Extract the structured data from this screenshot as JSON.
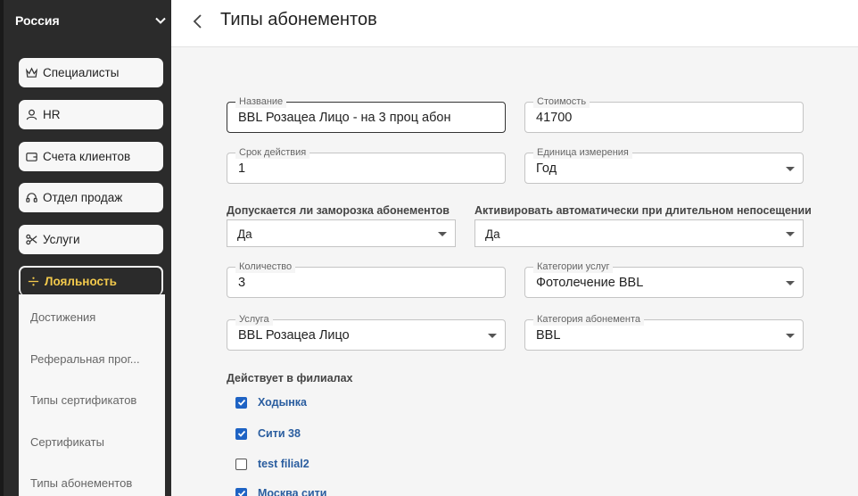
{
  "sidebar": {
    "region": "Россия",
    "items": [
      {
        "label": "Специалисты",
        "icon": "crown-icon"
      },
      {
        "label": "HR",
        "icon": "user-icon"
      },
      {
        "label": "Счета клиентов",
        "icon": "wallet-icon"
      },
      {
        "label": "Отдел продаж",
        "icon": "headset-icon"
      },
      {
        "label": "Услуги",
        "icon": "scissors-icon"
      },
      {
        "label": "Лояльность",
        "icon": "divide-icon"
      }
    ],
    "submenu": [
      "Достижения",
      "Реферальная прог...",
      "Типы сертификатов",
      "Сертификаты",
      "Типы абонементов"
    ]
  },
  "header": {
    "title": "Типы абонементов"
  },
  "form": {
    "name": {
      "label": "Название",
      "value": "BBL Розацеа Лицо - на 3 проц абон"
    },
    "price": {
      "label": "Стоимость",
      "value": "41700"
    },
    "duration": {
      "label": "Срок действия",
      "value": "1"
    },
    "unit": {
      "label": "Единица измерения",
      "value": "Год"
    },
    "freeze": {
      "label": "Допускается ли заморозка абонементов",
      "value": "Да"
    },
    "autoactivate": {
      "label": "Активировать автоматически при длительном непосещении",
      "value": "Да"
    },
    "quantity": {
      "label": "Количество",
      "value": "3"
    },
    "service_category": {
      "label": "Категории услуг",
      "value": "Фотолечение BBL"
    },
    "service": {
      "label": "Услуга",
      "value": "BBL Розацеа Лицо"
    },
    "subscription_category": {
      "label": "Категория абонемента",
      "value": "BBL"
    },
    "branches_label": "Действует в филиалах",
    "branches": [
      {
        "label": "Ходынка",
        "checked": true
      },
      {
        "label": "Сити 38",
        "checked": true
      },
      {
        "label": "test filial2",
        "checked": false
      },
      {
        "label": "Москва сити",
        "checked": true
      }
    ]
  },
  "colors": {
    "accent": "#1e63c4",
    "active_text": "#f2c94c",
    "sidebar_bg": "#2b2b2b"
  }
}
